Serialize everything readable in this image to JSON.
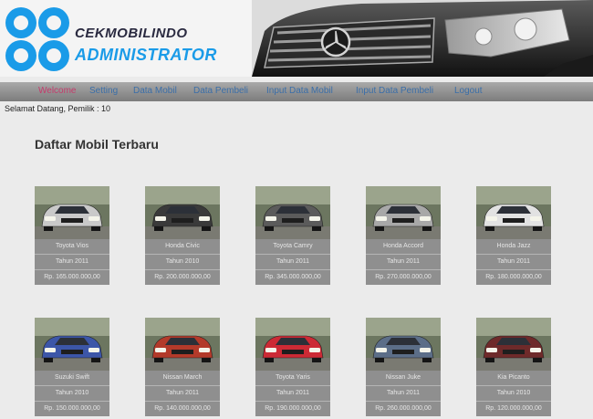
{
  "header": {
    "logo_line1": "CEKMOBILINDO",
    "logo_line2": "ADMINISTRATOR"
  },
  "nav": {
    "items": [
      {
        "label": "Welcome"
      },
      {
        "label": "Setting"
      },
      {
        "label": "Data Mobil"
      },
      {
        "label": "Data Pembeli"
      },
      {
        "label": "Input Data Mobil"
      },
      {
        "label": "Input Data Pembeli"
      },
      {
        "label": "Logout"
      }
    ]
  },
  "greeting": "Selamat Datang, Pemilik : 10",
  "page_title": "Daftar Mobil Terbaru",
  "cars": [
    {
      "name": "Toyota Vios",
      "year": "Tahun 2011",
      "price": "Rp. 165.000.000,00",
      "icon": "silver-sedan-photo",
      "body_color": "#c9c9c9"
    },
    {
      "name": "Honda Civic",
      "year": "Tahun 2010",
      "price": "Rp. 200.000.000,00",
      "icon": "dark-sedan-photo",
      "body_color": "#3a3a3a"
    },
    {
      "name": "Toyota Camry",
      "year": "Tahun 2011",
      "price": "Rp. 345.000.000,00",
      "icon": "dark-gray-sedan-photo",
      "body_color": "#5b5b5b"
    },
    {
      "name": "Honda Accord",
      "year": "Tahun 2011",
      "price": "Rp. 270.000.000,00",
      "icon": "silver-sedan-photo",
      "body_color": "#a8a8a8"
    },
    {
      "name": "Honda Jazz",
      "year": "Tahun 2011",
      "price": "Rp. 180.000.000,00",
      "icon": "white-hatchback-photo",
      "body_color": "#e2e2e2"
    },
    {
      "name": "Suzuki Swift",
      "year": "Tahun 2010",
      "price": "Rp. 150.000.000,00",
      "icon": "blue-hatchback-photo",
      "body_color": "#3c56a8"
    },
    {
      "name": "Nissan March",
      "year": "Tahun 2011",
      "price": "Rp. 140.000.000,00",
      "icon": "red-suv-photo",
      "body_color": "#b33a2a"
    },
    {
      "name": "Toyota Yaris",
      "year": "Tahun 2011",
      "price": "Rp. 190.000.000,00",
      "icon": "red-hatchback-photo",
      "body_color": "#cc2a35"
    },
    {
      "name": "Nissan Juke",
      "year": "Tahun 2011",
      "price": "Rp. 260.000.000,00",
      "icon": "blue-gray-suv-photo",
      "body_color": "#5c6e88"
    },
    {
      "name": "Kia Picanto",
      "year": "Tahun 2010",
      "price": "Rp. 120.000.000,00",
      "icon": "maroon-hatchback-photo",
      "body_color": "#6e2a2a"
    }
  ],
  "colors": {
    "background": "#ebebeb",
    "nav_link": "#3a6ea8",
    "nav_active": "#c43b6b",
    "logo_blue": "#1a9be8",
    "caption_bg": "#8f8f8f"
  }
}
